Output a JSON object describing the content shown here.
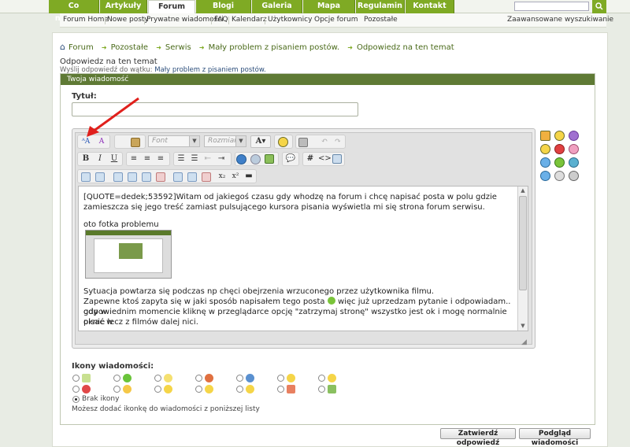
{
  "top_nav": {
    "tabs": [
      {
        "label": "Co nowego?"
      },
      {
        "label": "Artykuły"
      },
      {
        "label": "Forum"
      },
      {
        "label": "Blogi"
      },
      {
        "label": "Galeria"
      },
      {
        "label": "Mapa łowisk"
      },
      {
        "label": "Regulamin"
      },
      {
        "label": "Kontakt"
      }
    ],
    "search_icon": "search-icon"
  },
  "sub_nav": {
    "items": [
      {
        "label": "Forum Home"
      },
      {
        "label": "Nowe posty"
      },
      {
        "label": "Prywatne wiadomości"
      },
      {
        "label": "FAQ"
      },
      {
        "label": "Kalendarz"
      },
      {
        "label": "Użytkownicy"
      },
      {
        "label": "Opcje forum"
      },
      {
        "label": "Pozostałe"
      }
    ],
    "advanced_search": "Zaawansowane wyszukiwanie"
  },
  "breadcrumb": {
    "items": [
      "Forum",
      "Pozostałe",
      "Serwis",
      "Mały problem z pisaniem postów.",
      "Odpowiedz na ten temat"
    ]
  },
  "page": {
    "heading": "Odpowiedz na ten temat",
    "sub_prefix": "Wyślij odpowiedź do wątku:",
    "sub_thread": "Mały problem z pisaniem postów."
  },
  "panel": {
    "header": "Twoja wiadomość",
    "title_label": "Tytuł:",
    "font_placeholder": "Font",
    "size_placeholder": "Rozmiar",
    "message_lines": [
      "[QUOTE=dedek;53592]Witam od jakiegoś czasu gdy whodzę na forum i chcę napisać posta w polu gdzie",
      "zamieszcza się jego treść zamiast pulsującego kursora pisania wyświetla mi się strona forum serwisu.",
      "",
      "oto fotka problemu",
      "Sytuacja powtarza się podczas np chęci obejrzenia wrzuconego przez użytkownika filmu.",
      "Zapewne ktoś zapyta się w jaki sposób napisałem tego posta",
      "więc już uprzedzam pytanie i odpowiadam.. gdy w",
      "odpowiednim momencie kliknę w przeglądarce opcję \"zatrzymaj stronę\" wszystko jest ok i mogę normalnie pisać w",
      "oknie lecz z filmów dalej nici."
    ]
  },
  "message_icons": {
    "label": "Ikony wiadomości:",
    "no_icon": "Brak ikony",
    "hint": "Możesz dodać ikonkę do wiadomości z poniższej listy"
  },
  "buttons": {
    "submit": "Zatwierdź odpowiedź",
    "preview": "Podgląd wiadomości"
  },
  "colors": {
    "nav_green": "#7faa24",
    "panel_header": "#5f7a35",
    "arrow_red": "#e0201c"
  }
}
